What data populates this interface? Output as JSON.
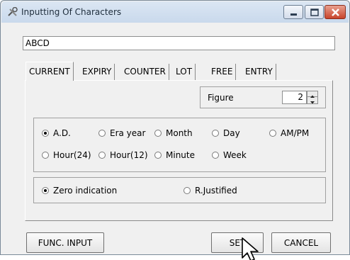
{
  "window": {
    "title": "Inputting Of Characters",
    "icon": "tools-icon"
  },
  "text_field": {
    "value": "ABCD"
  },
  "tabs": [
    {
      "label": "CURRENT",
      "active": true
    },
    {
      "label": "EXPIRY",
      "active": false
    },
    {
      "label": "COUNTER",
      "active": false
    },
    {
      "label": "LOT",
      "active": false
    },
    {
      "label": "FREE",
      "active": false
    },
    {
      "label": "ENTRY",
      "active": false
    }
  ],
  "figure": {
    "label": "Figure",
    "value": "2"
  },
  "date_options": [
    {
      "label": "A.D.",
      "checked": true
    },
    {
      "label": "Era year",
      "checked": false
    },
    {
      "label": "Month",
      "checked": false
    },
    {
      "label": "Day",
      "checked": false
    },
    {
      "label": "AM/PM",
      "checked": false
    },
    {
      "label": "Hour(24)",
      "checked": false
    },
    {
      "label": "Hour(12)",
      "checked": false
    },
    {
      "label": "Minute",
      "checked": false
    },
    {
      "label": "Week",
      "checked": false
    }
  ],
  "justify_options": [
    {
      "label": "Zero indication",
      "checked": true
    },
    {
      "label": "R.Justified",
      "checked": false
    }
  ],
  "buttons": {
    "func_input": "FUNC. INPUT",
    "set": "SET",
    "cancel": "CANCEL"
  },
  "colors": {
    "close_button": "#c8442b",
    "titlebar": "#c9d9ec",
    "dialog_bg": "#f0f0f0"
  }
}
